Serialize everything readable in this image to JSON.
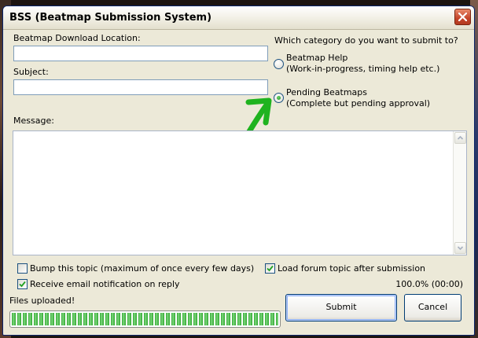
{
  "window": {
    "title": "BSS (Beatmap Submission System)"
  },
  "form": {
    "download_label": "Beatmap Download Location:",
    "download_value": "",
    "subject_label": "Subject:",
    "subject_value": "",
    "message_label": "Message:",
    "message_value": ""
  },
  "category": {
    "prompt": "Which category do you want to submit to?",
    "options": [
      {
        "line1": "Beatmap Help",
        "line2": "(Work-in-progress, timing help etc.)",
        "selected": false
      },
      {
        "line1": "Pending Beatmaps",
        "line2": "(Complete but pending approval)",
        "selected": true
      }
    ]
  },
  "options": {
    "bump_label": "Bump this topic (maximum of once every few days)",
    "bump_checked": false,
    "load_forum_label": "Load forum topic after submission",
    "load_forum_checked": true,
    "email_label": "Receive email notification on reply",
    "email_checked": true
  },
  "status": {
    "uploaded_text": "Files uploaded!",
    "progress_text": "100.0% (00:00)",
    "progress_fraction": 1.0
  },
  "buttons": {
    "submit": "Submit",
    "cancel": "Cancel"
  },
  "colors": {
    "annotation_arrow": "#1fb31f",
    "title_border": "#0a246a",
    "close_button": "#c4442a"
  },
  "icons": {
    "close": "close-icon",
    "arrow": "arrow-annotation"
  }
}
